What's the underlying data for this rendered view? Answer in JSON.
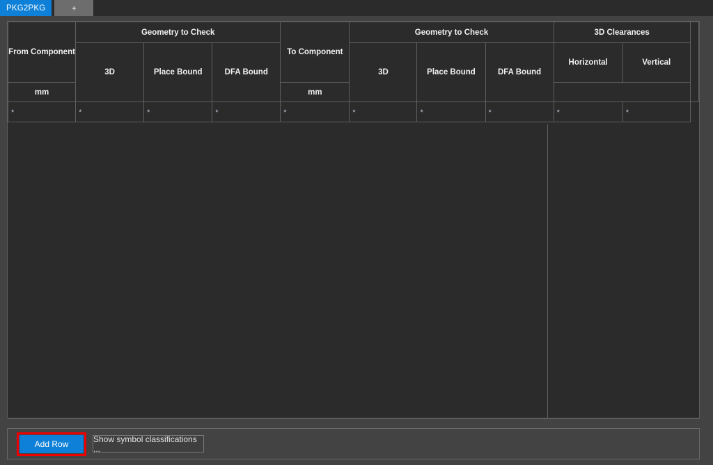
{
  "tabs": [
    {
      "label": "PKG2PKG",
      "active": true
    },
    {
      "label": "+",
      "active": false
    }
  ],
  "table": {
    "group_headers": {
      "from_component": "From Component",
      "geometry_to_check_1": "Geometry to Check",
      "to_component": "To Component",
      "geometry_to_check_2": "Geometry to Check",
      "clearances_3d": "3D Clearances"
    },
    "sub_headers": {
      "from_3d": "3D",
      "from_place_bound": "Place Bound",
      "from_dfa_bound": "DFA Bound",
      "to_3d": "3D",
      "to_place_bound": "Place Bound",
      "to_dfa_bound": "DFA Bound",
      "horizontal": "Horizontal",
      "vertical": "Vertical"
    },
    "unit_headers": {
      "horizontal_unit": "mm",
      "vertical_unit": "mm"
    },
    "rows": [
      {
        "from_component": "*",
        "from_3d": "*",
        "from_place_bound": "*",
        "from_dfa_bound": "*",
        "to_component": "*",
        "to_3d": "*",
        "to_place_bound": "*",
        "to_dfa_bound": "*",
        "horizontal": "*",
        "vertical": "*"
      }
    ]
  },
  "actions": {
    "add_row": "Add Row",
    "show_symbol_classifications": "Show symbol classifications ..."
  },
  "colors": {
    "accent": "#0e80d8",
    "highlight": "#ee0000",
    "panel_bg": "#434343",
    "grid_bg": "#2b2b2b",
    "grid_line": "#5e5e5e"
  }
}
